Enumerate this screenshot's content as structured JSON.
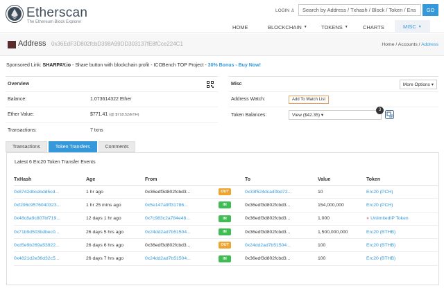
{
  "header": {
    "brand": "Etherscan",
    "tagline": "The Ethereum Block Explorer",
    "login": "LOGIN",
    "search_placeholder": "Search by Address / Txhash / Block / Token / Ens",
    "go": "GO",
    "nav": [
      "HOME",
      "BLOCKCHAIN",
      "TOKENS",
      "CHARTS",
      "MISC"
    ]
  },
  "title": {
    "label": "Address",
    "hash": "0x36EdF3D802fcbD398A99DD303137fE8fCce224C1",
    "breadcrumbs": [
      "Home",
      "/",
      "Accounts",
      "/",
      "Address"
    ]
  },
  "sponsor": {
    "prefix": "Sponsored Link:",
    "name": "SHARPAY.io",
    "text": " - Share button with blockchain profit - ICOBench TOP Project - ",
    "bonus": "30% Bonus - Buy Now!"
  },
  "overview": {
    "title": "Overview",
    "balance_label": "Balance:",
    "balance": "1.073614322 Ether",
    "value_label": "Ether Value:",
    "value": "$771.41",
    "value_note": "(@ $718.52/ETH)",
    "tx_label": "Transactions:",
    "tx": "7 txns"
  },
  "misc": {
    "title": "Misc",
    "more_options": "More Options",
    "watch_label": "Address Watch:",
    "watch_btn": "Add To Watch List",
    "token_label": "Token Balances:",
    "token_value": "View ($42.35)",
    "token_count": "3"
  },
  "tabs": [
    "Transactions",
    "Token Transfers",
    "Comments"
  ],
  "events_title": "Latest 6 Erc20 Token Transfer Events",
  "table": {
    "headers": [
      "TxHash",
      "Age",
      "From",
      "",
      "To",
      "Value",
      "Token"
    ],
    "rows": [
      {
        "hash": "0x8742dbcebdd5cd...",
        "age": "1 hr ago",
        "from": "0x36edf3d802fcbd3...",
        "dir": "OUT",
        "to": "0x33f524dca40bd72...",
        "value": "10",
        "token": "Erc20 (PCH)"
      },
      {
        "hash": "0xf296c9576040323...",
        "age": "1 hr 25 mins ago",
        "from": "0x5e147a9ff31786...",
        "dir": "IN",
        "to": "0x36edf3d802fcbd3...",
        "value": "154,000,000",
        "token": "Erc20 (PCH)"
      },
      {
        "hash": "0x48c8a9c807bf719...",
        "age": "12 days 1 hr ago",
        "from": "0x7c983c2a784e48...",
        "dir": "IN",
        "to": "0x36edf3d802fcbd3...",
        "value": "1,000",
        "token": "UnlimitedIP Token"
      },
      {
        "hash": "0x71b9d503bdbec0...",
        "age": "26 days 5 hrs ago",
        "from": "0x24dd2ad7b51504...",
        "dir": "IN",
        "to": "0x36edf3d802fcbd3...",
        "value": "1,500,000,000",
        "token": "Erc20 (BTHB)"
      },
      {
        "hash": "0xd5e9b269a53922...",
        "age": "26 days 6 hrs ago",
        "from": "0x36edf3d802fcbd3...",
        "dir": "OUT",
        "to": "0x24dd2ad7b51504...",
        "value": "100",
        "token": "Erc20 (BTHB)"
      },
      {
        "hash": "0x4821d2e36d32c5...",
        "age": "26 days 7 hrs ago",
        "from": "0x24dd2ad7b51504...",
        "dir": "IN",
        "to": "0x36edf3d802fcbd3...",
        "value": "100",
        "token": "Erc20 (BTHB)"
      }
    ]
  },
  "colors": {
    "accent": "#3498db",
    "out": "#f0a430",
    "in": "#3fbc53"
  }
}
